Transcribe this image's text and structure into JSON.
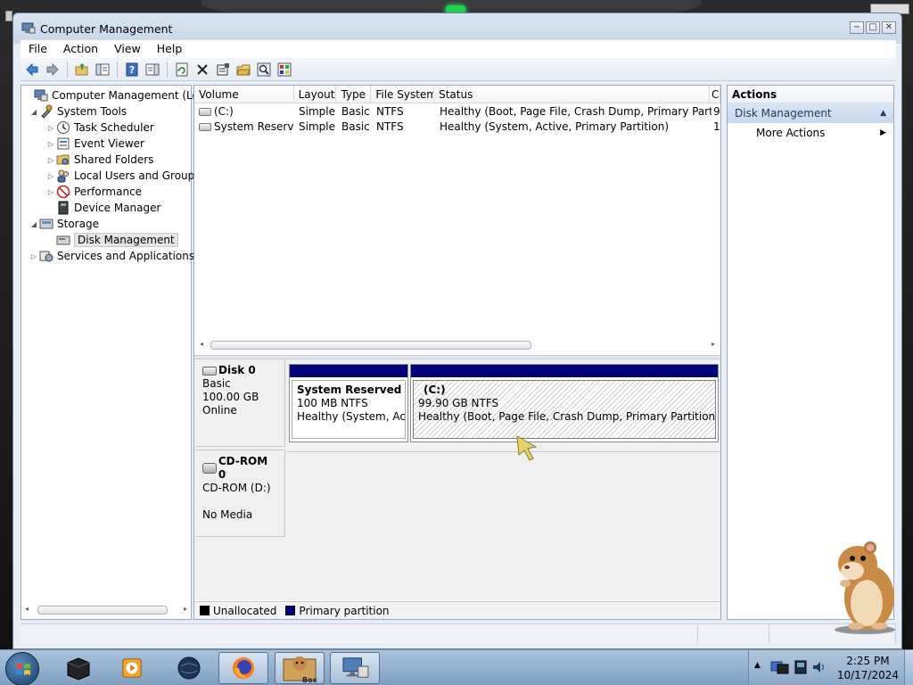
{
  "window": {
    "title": "Computer Management",
    "controls": {
      "minimize": "−",
      "maximize": "□",
      "close": "✕"
    }
  },
  "menu": [
    "File",
    "Action",
    "View",
    "Help"
  ],
  "toolbar": {
    "icons": [
      "back-arrow-icon",
      "forward-arrow-icon",
      "up-folder-icon",
      "show-hide-tree-icon",
      "help-icon",
      "properties-pane-icon",
      "refresh-icon",
      "delete-icon",
      "properties-icon",
      "open-icon",
      "search-icon",
      "settings-icon"
    ]
  },
  "tree": {
    "items": [
      {
        "label": "Computer Management (Local",
        "level": 0,
        "expander": "",
        "icon": "computer-management-icon"
      },
      {
        "label": "System Tools",
        "level": 1,
        "expander": "◢",
        "icon": "system-tools-icon"
      },
      {
        "label": "Task Scheduler",
        "level": 2,
        "expander": "▷",
        "icon": "task-scheduler-icon"
      },
      {
        "label": "Event Viewer",
        "level": 2,
        "expander": "▷",
        "icon": "event-viewer-icon"
      },
      {
        "label": "Shared Folders",
        "level": 2,
        "expander": "▷",
        "icon": "shared-folders-icon"
      },
      {
        "label": "Local Users and Groups",
        "level": 2,
        "expander": "▷",
        "icon": "local-users-icon"
      },
      {
        "label": "Performance",
        "level": 2,
        "expander": "▷",
        "icon": "performance-icon"
      },
      {
        "label": "Device Manager",
        "level": 2,
        "expander": "",
        "icon": "device-manager-icon"
      },
      {
        "label": "Storage",
        "level": 1,
        "expander": "◢",
        "icon": "storage-icon"
      },
      {
        "label": "Disk Management",
        "level": 2,
        "expander": "",
        "icon": "disk-management-icon",
        "selected": true
      },
      {
        "label": "Services and Applications",
        "level": 1,
        "expander": "▷",
        "icon": "services-applications-icon"
      }
    ]
  },
  "volumes": {
    "columns": [
      "Volume",
      "Layout",
      "Type",
      "File System",
      "Status",
      "C"
    ],
    "rows": [
      [
        "(C:)",
        "Simple",
        "Basic",
        "NTFS",
        "Healthy (Boot, Page File, Crash Dump, Primary Partition)",
        "9"
      ],
      [
        "System Reserved",
        "Simple",
        "Basic",
        "NTFS",
        "Healthy (System, Active, Primary Partition)",
        "1"
      ]
    ]
  },
  "disks": {
    "disk0": {
      "name": "Disk 0",
      "type": "Basic",
      "size": "100.00 GB",
      "state": "Online",
      "partitions": [
        {
          "title": "System Reserved",
          "size": "100 MB NTFS",
          "status": "Healthy (System, Active"
        },
        {
          "title": "(C:)",
          "size": "99.90 GB NTFS",
          "status": "Healthy (Boot, Page File, Crash Dump, Primary Partition)"
        }
      ]
    },
    "cdrom0": {
      "name": "CD-ROM 0",
      "drive": "CD-ROM (D:)",
      "media": "No Media"
    }
  },
  "legend": [
    {
      "label": "Unallocated",
      "color": "#000000"
    },
    {
      "label": "Primary partition",
      "color": "#00007f"
    }
  ],
  "actions": {
    "title": "Actions",
    "section": "Disk Management",
    "items": [
      "More Actions"
    ]
  },
  "taskbar": {
    "apps": [
      "black-box-app-icon",
      "media-player-icon",
      "globe-app-icon",
      "firefox-icon",
      "hamster-box-icon",
      "computer-management-taskbar-icon"
    ],
    "hamster_box_label": "Box",
    "clock": {
      "time": "2:25 PM",
      "date": "10/17/2024"
    },
    "tray_expand": "▲"
  },
  "colors": {
    "primary_partition": "#00007f",
    "selection_header": "#c6d8ec"
  }
}
